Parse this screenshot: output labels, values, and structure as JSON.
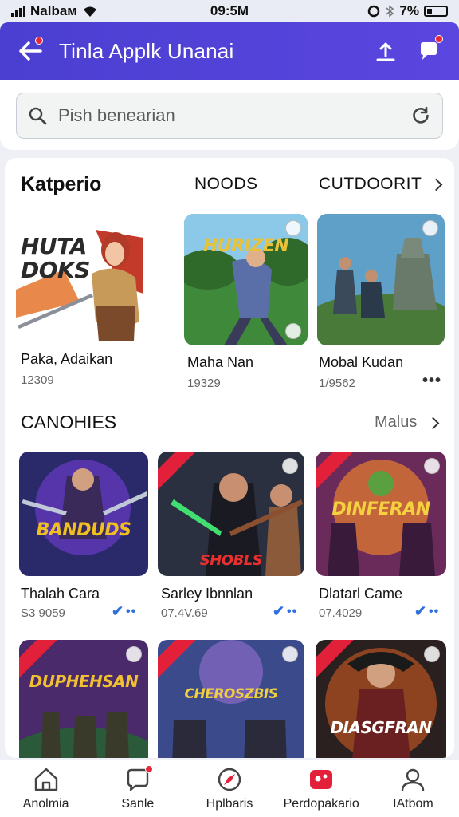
{
  "status_bar": {
    "carrier": "Nalbaм",
    "time": "09:5M",
    "battery": "7%"
  },
  "app_bar": {
    "title": "Tinla Applk Unanai"
  },
  "search": {
    "placeholder": "Pish benearian"
  },
  "section1": {
    "title": "Katperio",
    "tab1": "NOODS",
    "tab2": "CUTDOORIT",
    "cards": [
      {
        "art_text_top": "HUTA",
        "art_text_bottom": "DOKS",
        "name": "Paka, Adaikan",
        "meta": "12309"
      },
      {
        "art_text": "HURIZEN",
        "name": "Maha Nan",
        "meta": "19329"
      },
      {
        "name": "Mobal Kudan",
        "meta": "1/9562"
      }
    ]
  },
  "section2": {
    "title": "CANOHIES",
    "more": "Malus",
    "cards": [
      {
        "art_text": "BANDUDS",
        "name": "Thalah Cara",
        "meta": "S3 9059"
      },
      {
        "art_text": "SHOBLS",
        "name": "Sarley Ibnnlan",
        "meta": "07.4V.69"
      },
      {
        "art_text": "DINFERAN",
        "name": "Dlatarl Came",
        "meta": "07.4029"
      }
    ]
  },
  "section3": {
    "cards": [
      {
        "art_text": "DUPHEHSAN"
      },
      {
        "art_text": "CHEROSZBIS"
      },
      {
        "art_text": "DIASGFRAN"
      }
    ]
  },
  "bottom_nav": [
    {
      "label": "Anolmia",
      "icon": "home-icon"
    },
    {
      "label": "Sanle",
      "icon": "chat-icon"
    },
    {
      "label": "Hplbaris",
      "icon": "compass-icon"
    },
    {
      "label": "Perdopakario",
      "icon": "games-icon"
    },
    {
      "label": "IAtbom",
      "icon": "profile-icon"
    }
  ],
  "colors": {
    "app_bar": "#4a3fd0",
    "badge": "#e8283a",
    "verified": "#2f6fe0"
  }
}
